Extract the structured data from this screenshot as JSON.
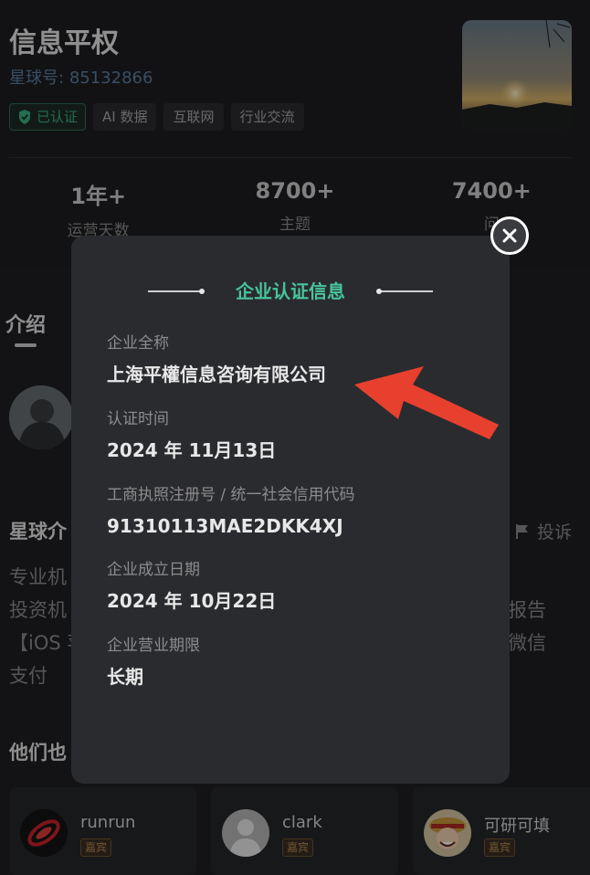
{
  "planet": {
    "title": "信息平权",
    "id_label": "星球号:",
    "id_value": "85132866",
    "tags": [
      "已认证",
      "AI 数据",
      "互联网",
      "行业交流"
    ]
  },
  "stats": [
    {
      "value": "1年+",
      "label": "运营天数"
    },
    {
      "value": "8700+",
      "label": "主题"
    },
    {
      "value": "7400+",
      "label": "问"
    }
  ],
  "intro": {
    "tab_label": "介绍",
    "planet_intro_heading": "星球介",
    "report_label": "投诉",
    "desc_left": "专业机\n投资机\n【iOS 苹\n支付",
    "desc_right": "报告\n微信",
    "members_heading": "他们也"
  },
  "members": [
    {
      "name": "runrun",
      "badge": "嘉宾"
    },
    {
      "name": "clark",
      "badge": "嘉宾"
    },
    {
      "name": "可研可填",
      "badge": "嘉宾"
    }
  ],
  "modal": {
    "title": "企业认证信息",
    "fields": [
      {
        "label": "企业全称",
        "value": "上海平權信息咨询有限公司"
      },
      {
        "label": "认证时间",
        "value": "2024 年 11月13日"
      },
      {
        "label": "工商执照注册号 / 统一社会信用代码",
        "value": "91310113MAE2DKK4XJ"
      },
      {
        "label": "企业成立日期",
        "value": "2024 年 10月22日"
      },
      {
        "label": "企业营业期限",
        "value": "长期"
      }
    ]
  },
  "colors": {
    "accent_green": "#48c49a",
    "link_blue": "#5b7fa3",
    "arrow_red": "#e8402e"
  },
  "icons": [
    "shield-check-icon",
    "close-icon",
    "flag-icon",
    "arrow-annotation"
  ]
}
